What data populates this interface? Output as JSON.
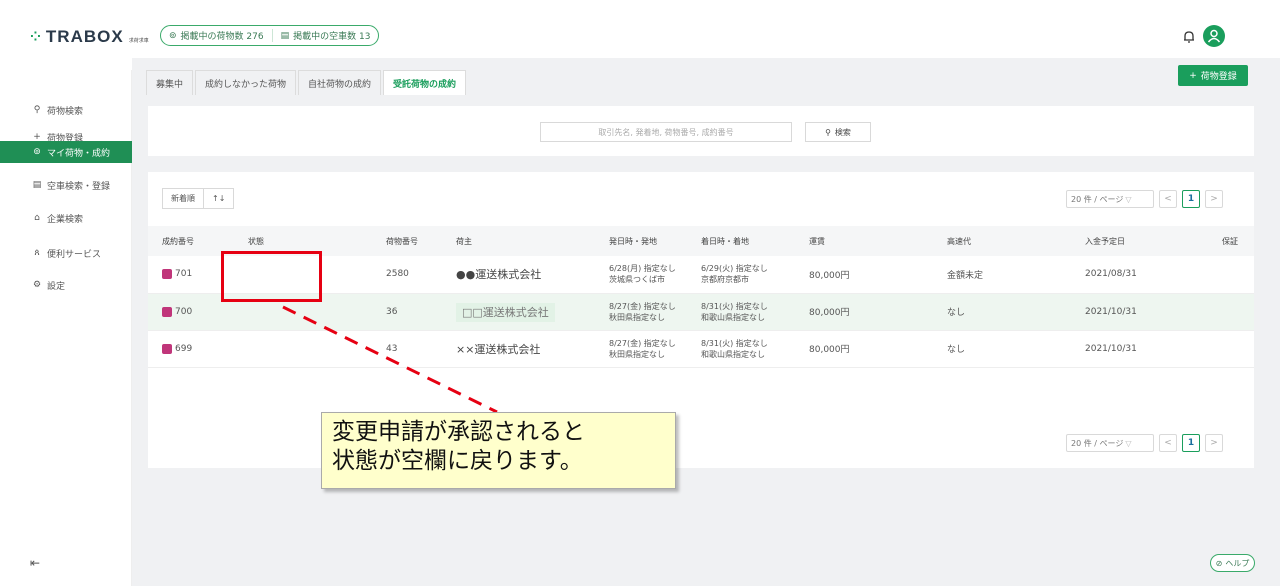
{
  "header": {
    "logo_text": "TRABOX",
    "logo_sub": "求荷求車",
    "pill_cargo": "掲載中の荷物数 276",
    "pill_trucks": "掲載中の空車数 13"
  },
  "sidebar": {
    "items": [
      {
        "label": "荷物検索",
        "icon": "search-icon"
      },
      {
        "label": "荷物登録",
        "icon": "plus-icon"
      },
      {
        "label": "マイ荷物・成約",
        "icon": "box-icon"
      },
      {
        "label": "空車検索・登録",
        "icon": "truck-icon"
      },
      {
        "label": "企業検索",
        "icon": "building-icon"
      },
      {
        "label": "便利サービス",
        "icon": "people-icon"
      },
      {
        "label": "設定",
        "icon": "gear-icon"
      }
    ]
  },
  "tabs": [
    {
      "label": "募集中"
    },
    {
      "label": "成約しなかった荷物"
    },
    {
      "label": "自社荷物の成約"
    },
    {
      "label": "受託荷物の成約"
    }
  ],
  "add_button": "荷物登録",
  "search": {
    "placeholder": "取引先名, 発着地, 荷物番号, 成約番号",
    "button": "検索"
  },
  "sort": {
    "label": "新着順",
    "toggle": "↑↓"
  },
  "pager": {
    "size": "20 件 / ページ",
    "prev": "<",
    "current": "1",
    "next": ">"
  },
  "table": {
    "headers": [
      "成約番号",
      "状態",
      "荷物番号",
      "荷主",
      "発日時・発地",
      "着日時・着地",
      "運賃",
      "高速代",
      "入金予定日",
      "保証"
    ],
    "rows": [
      {
        "id": "701",
        "status": "",
        "cargo_no": "2580",
        "shipper": "●●運送株式会社",
        "dep1": "6/28(月) 指定なし",
        "dep2": "茨城県つくば市",
        "arr1": "6/29(火) 指定なし",
        "arr2": "京都府京都市",
        "fare": "80,000円",
        "toll": "金額未定",
        "date": "2021/08/31",
        "guarantee": ""
      },
      {
        "id": "700",
        "status": "",
        "cargo_no": "36",
        "shipper": "□□運送株式会社",
        "dep1": "8/27(金) 指定なし",
        "dep2": "秋田県指定なし",
        "arr1": "8/31(火) 指定なし",
        "arr2": "和歌山県指定なし",
        "fare": "80,000円",
        "toll": "なし",
        "date": "2021/10/31",
        "guarantee": ""
      },
      {
        "id": "699",
        "status": "",
        "cargo_no": "43",
        "shipper": "××運送株式会社",
        "dep1": "8/27(金) 指定なし",
        "dep2": "秋田県指定なし",
        "arr1": "8/31(火) 指定なし",
        "arr2": "和歌山県指定なし",
        "fare": "80,000円",
        "toll": "なし",
        "date": "2021/10/31",
        "guarantee": ""
      }
    ]
  },
  "help": "ヘルプ",
  "callout": {
    "line1": "変更申請が承認されると",
    "line2": "状態が空欄に戻ります。"
  },
  "colors": {
    "brand": "#1a9e5c",
    "annotation": "#e60012",
    "callout_bg": "#ffffcc"
  }
}
